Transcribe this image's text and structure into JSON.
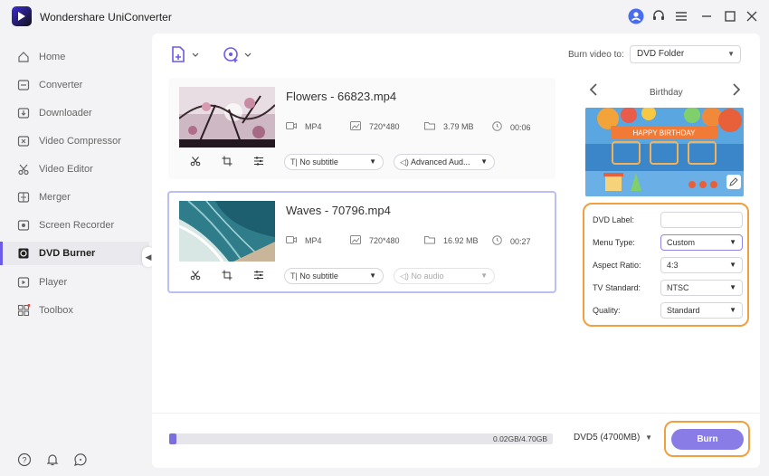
{
  "app": {
    "title": "Wondershare UniConverter"
  },
  "sidebar": {
    "items": [
      {
        "label": "Home",
        "icon": "home-icon"
      },
      {
        "label": "Converter",
        "icon": "converter-icon"
      },
      {
        "label": "Downloader",
        "icon": "downloader-icon"
      },
      {
        "label": "Video Compressor",
        "icon": "compressor-icon"
      },
      {
        "label": "Video Editor",
        "icon": "scissors-icon"
      },
      {
        "label": "Merger",
        "icon": "merger-icon"
      },
      {
        "label": "Screen Recorder",
        "icon": "recorder-icon"
      },
      {
        "label": "DVD Burner",
        "icon": "dvd-icon",
        "active": true
      },
      {
        "label": "Player",
        "icon": "play-icon"
      },
      {
        "label": "Toolbox",
        "icon": "toolbox-icon"
      }
    ]
  },
  "toolbar": {
    "burn_to_label": "Burn video to:",
    "burn_to_value": "DVD Folder"
  },
  "videos": [
    {
      "title": "Flowers - 66823.mp4",
      "format": "MP4",
      "resolution": "720*480",
      "size": "3.79 MB",
      "duration": "00:06",
      "subtitle": "No subtitle",
      "audio": "Advanced Aud..."
    },
    {
      "title": "Waves - 70796.mp4",
      "format": "MP4",
      "resolution": "720*480",
      "size": "16.92 MB",
      "duration": "00:27",
      "subtitle": "No subtitle",
      "audio": "No audio"
    }
  ],
  "template": {
    "name": "Birthday",
    "banner_text": "HAPPY BIRTHDAY"
  },
  "settings": {
    "dvd_label": {
      "label": "DVD Label:",
      "value": ""
    },
    "menu_type": {
      "label": "Menu Type:",
      "value": "Custom"
    },
    "aspect_ratio": {
      "label": "Aspect Ratio:",
      "value": "4:3"
    },
    "tv_standard": {
      "label": "TV Standard:",
      "value": "NTSC"
    },
    "quality": {
      "label": "Quality:",
      "value": "Standard"
    }
  },
  "bottom": {
    "progress_text": "0.02GB/4.70GB",
    "progress_fraction": 0.004,
    "disc_type": "DVD5 (4700MB)",
    "burn_label": "Burn"
  },
  "colors": {
    "accent": "#7b6fe0",
    "highlight": "#f0a040"
  }
}
